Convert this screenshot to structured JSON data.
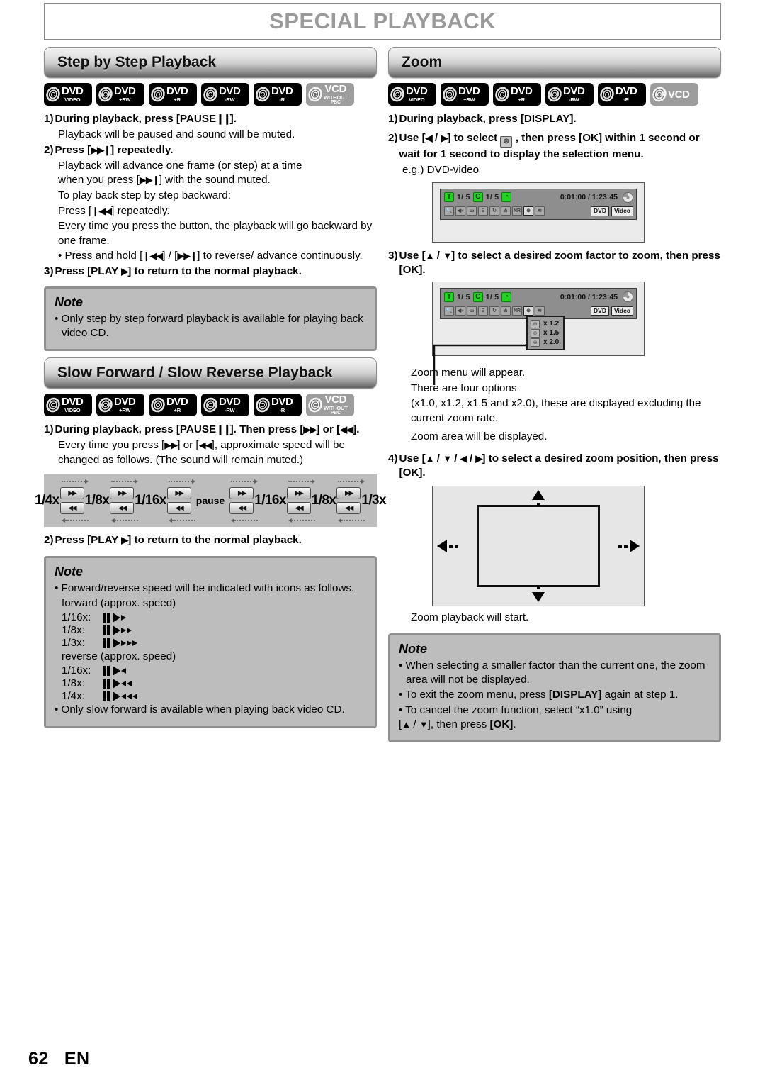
{
  "page": {
    "title": "SPECIAL PLAYBACK",
    "footer_number": "62",
    "footer_lang": "EN"
  },
  "left": {
    "section1": {
      "heading": "Step by Step Playback",
      "badges": [
        {
          "big": "DVD",
          "sub": "VIDEO",
          "sub2": "",
          "style": "dark"
        },
        {
          "big": "DVD",
          "sub": "+RW",
          "sub2": "",
          "style": "dark"
        },
        {
          "big": "DVD",
          "sub": "+R",
          "sub2": "",
          "style": "dark"
        },
        {
          "big": "DVD",
          "sub": "-RW",
          "sub2": "",
          "style": "dark"
        },
        {
          "big": "DVD",
          "sub": "-R",
          "sub2": "",
          "style": "dark"
        },
        {
          "big": "VCD",
          "sub": "WITHOUT",
          "sub2": "PBC",
          "style": "grey"
        }
      ],
      "step1_num": "1)",
      "step1_text": "During playback, press [PAUSE",
      "step1_text_end": "].",
      "step1_body": "Playback will be paused and sound will be muted.",
      "step2_num": "2)",
      "step2_pre": "Press [",
      "step2_post": "] repeatedly.",
      "step2_body1": "Playback will advance one frame (or step) at a time",
      "step2_body2_pre": "when you press [",
      "step2_body2_post": "] with the sound muted.",
      "step2_body3": "To play back step by step backward:",
      "step2_body4_pre": "Press [",
      "step2_body4_post": "] repeatedly.",
      "step2_body5": "Every time you press the button, the playback will go backward by one frame.",
      "step2_bullet_pre": "Press and hold [",
      "step2_bullet_mid": "] / [",
      "step2_bullet_post": "] to reverse/ advance continuously.",
      "step3_num": "3)",
      "step3_pre": "Press [PLAY ",
      "step3_post": "] to return to the normal playback.",
      "note_title": "Note",
      "note_b1": "Only step by step forward playback is available for playing back video CD."
    },
    "section2": {
      "heading": "Slow Forward / Slow Reverse Playback",
      "badges": [
        {
          "big": "DVD",
          "sub": "VIDEO",
          "sub2": "",
          "style": "dark"
        },
        {
          "big": "DVD",
          "sub": "+RW",
          "sub2": "",
          "style": "dark"
        },
        {
          "big": "DVD",
          "sub": "+R",
          "sub2": "",
          "style": "dark"
        },
        {
          "big": "DVD",
          "sub": "-RW",
          "sub2": "",
          "style": "dark"
        },
        {
          "big": "DVD",
          "sub": "-R",
          "sub2": "",
          "style": "dark"
        },
        {
          "big": "VCD",
          "sub": "WITHOUT",
          "sub2": "PBC",
          "style": "grey"
        }
      ],
      "step1_num": "1)",
      "step1_a": "During playback, press [PAUSE",
      "step1_b": "]. Then press [",
      "step1_c": "] or [",
      "step1_d": "].",
      "step1_body_a": "Every time you press [",
      "step1_body_b": "] or [",
      "step1_body_c": "], approximate speed will be changed as follows. (The sound will remain muted.)",
      "speed_sequence": [
        "1/4x",
        "1/8x",
        "1/16x",
        "pause",
        "1/16x",
        "1/8x",
        "1/3x"
      ],
      "step2_num": "2)",
      "step2_pre": "Press [PLAY ",
      "step2_post": "] to return to the normal playback.",
      "note_title": "Note",
      "note_b1": "Forward/reverse speed will be indicated with icons as follows.",
      "note_fwd_label": "forward (approx. speed)",
      "note_fwd": [
        {
          "speed": "1/16x:",
          "arrows": 1
        },
        {
          "speed": "1/8x:",
          "arrows": 2
        },
        {
          "speed": "1/3x:",
          "arrows": 3
        }
      ],
      "note_rev_label": "reverse (approx. speed)",
      "note_rev": [
        {
          "speed": "1/16x:",
          "arrows": 1
        },
        {
          "speed": "1/8x:",
          "arrows": 2
        },
        {
          "speed": "1/4x:",
          "arrows": 3
        }
      ],
      "note_b2": "Only slow forward is available when playing back video CD."
    }
  },
  "right": {
    "section": {
      "heading": "Zoom",
      "badges": [
        {
          "big": "DVD",
          "sub": "VIDEO",
          "sub2": "",
          "style": "dark"
        },
        {
          "big": "DVD",
          "sub": "+RW",
          "sub2": "",
          "style": "dark"
        },
        {
          "big": "DVD",
          "sub": "+R",
          "sub2": "",
          "style": "dark"
        },
        {
          "big": "DVD",
          "sub": "-RW",
          "sub2": "",
          "style": "dark"
        },
        {
          "big": "DVD",
          "sub": "-R",
          "sub2": "",
          "style": "dark"
        },
        {
          "big": "VCD",
          "sub": "",
          "sub2": "",
          "style": "grey"
        }
      ],
      "step1_num": "1)",
      "step1_text": "During playback, press [DISPLAY].",
      "step2_num": "2)",
      "step2_a": "Use [",
      "step2_b": "] to select",
      "step2_c": ", then press [OK] within 1 second or wait for 1 second to display the selection menu.",
      "eg_label": "e.g.) DVD-video",
      "step3_num": "3)",
      "step3_a": "Use [",
      "step3_b": "] to select a desired zoom factor to zoom, then press [OK].",
      "body1": "Zoom menu will appear.",
      "body2": "There are four options",
      "body3": "(x1.0, x1.2, x1.5 and x2.0), these are displayed excluding the current zoom rate.",
      "body4": "Zoom area will be displayed.",
      "step4_num": "4)",
      "step4_a": "Use [",
      "step4_b": "] to select a desired zoom position, then press [OK].",
      "body5": "Zoom playback will start.",
      "note_title": "Note",
      "note_b1": "When selecting a smaller factor than the current one, the zoom area will not be displayed.",
      "note_b2_a": "To exit the zoom menu, press ",
      "note_b2_key": "[DISPLAY]",
      "note_b2_b": " again at step 1.",
      "note_b3_a": "To cancel the zoom function, select “x1.0” using",
      "note_b3_b": ", then press ",
      "note_b3_key": "[OK]",
      "note_b3_c": "."
    },
    "osd": {
      "title_badge": "T",
      "title_value": "1/  5",
      "chapter_badge": "C",
      "chapter_value": "1/  5",
      "time_badge": "◔",
      "time_value": "0:01:00 / 1:23:45",
      "icons": [
        "search-icon",
        "audio-icon",
        "subtitle-icon",
        "angle-icon",
        "repeat-icon",
        "marker-icon",
        "NR",
        "zoom-icon",
        "3d-icon"
      ],
      "nr_label": "NR",
      "tag1": "DVD",
      "tag2": "Video",
      "zoom_menu": [
        {
          "label": "x 1.2"
        },
        {
          "label": "x 1.5"
        },
        {
          "label": "x 2.0"
        }
      ]
    }
  }
}
